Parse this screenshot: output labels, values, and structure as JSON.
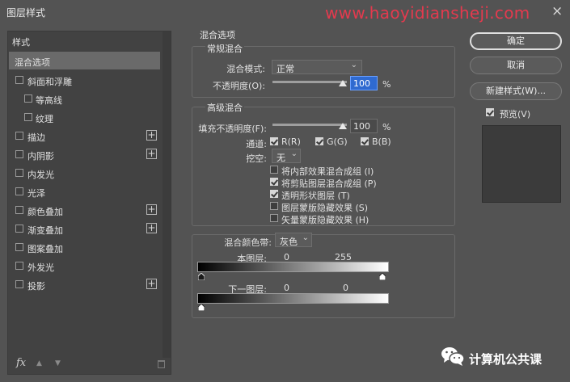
{
  "window": {
    "title": "图层样式",
    "watermark": "www.haoyidiansheji.com",
    "close_icon": "×"
  },
  "sidebar": {
    "header": "样式",
    "items": [
      {
        "label": "混合选项",
        "checkbox": false,
        "plus": false,
        "selected": true
      },
      {
        "label": "斜面和浮雕",
        "checkbox": true,
        "checked": false,
        "plus": false
      },
      {
        "label": "等高线",
        "checkbox": true,
        "checked": false,
        "plus": false,
        "indent": true
      },
      {
        "label": "纹理",
        "checkbox": true,
        "checked": false,
        "plus": false,
        "indent": true
      },
      {
        "label": "描边",
        "checkbox": true,
        "checked": false,
        "plus": true
      },
      {
        "label": "内阴影",
        "checkbox": true,
        "checked": false,
        "plus": true
      },
      {
        "label": "内发光",
        "checkbox": true,
        "checked": false,
        "plus": false
      },
      {
        "label": "光泽",
        "checkbox": true,
        "checked": false,
        "plus": false
      },
      {
        "label": "颜色叠加",
        "checkbox": true,
        "checked": false,
        "plus": true
      },
      {
        "label": "渐变叠加",
        "checkbox": true,
        "checked": false,
        "plus": true
      },
      {
        "label": "图案叠加",
        "checkbox": true,
        "checked": false,
        "plus": false
      },
      {
        "label": "外发光",
        "checkbox": true,
        "checked": false,
        "plus": false
      },
      {
        "label": "投影",
        "checkbox": true,
        "checked": false,
        "plus": true
      }
    ],
    "footer": {
      "fx_label": "fx",
      "up_arrow": "▲",
      "down_arrow": "▼"
    }
  },
  "blend_options": {
    "section_title": "混合选项",
    "general": {
      "title": "常规混合",
      "mode_label": "混合模式:",
      "mode_value": "正常",
      "opacity_label": "不透明度(O):",
      "opacity_value": "100",
      "opacity_unit": "%"
    },
    "advanced": {
      "title": "高级混合",
      "fill_label": "填充不透明度(F):",
      "fill_value": "100",
      "fill_unit": "%",
      "channels_label": "通道:",
      "channels": [
        {
          "label": "R(R)",
          "checked": true
        },
        {
          "label": "G(G)",
          "checked": true
        },
        {
          "label": "B(B)",
          "checked": true
        }
      ],
      "knockout_label": "挖空:",
      "knockout_value": "无",
      "options": [
        {
          "label": "将内部效果混合成组 (I)",
          "checked": false
        },
        {
          "label": "将剪贴图层混合成组 (P)",
          "checked": true
        },
        {
          "label": "透明形状图层 (T)",
          "checked": true
        },
        {
          "label": "图层蒙版隐藏效果 (S)",
          "checked": false
        },
        {
          "label": "矢量蒙版隐藏效果 (H)",
          "checked": false
        }
      ]
    },
    "blend_if": {
      "label": "混合颜色带:",
      "value": "灰色",
      "this_layer_label": "本图层:",
      "this_layer_low": "0",
      "this_layer_high": "255",
      "underlying_label": "下一图层:",
      "underlying_low": "0",
      "underlying_high": "0"
    }
  },
  "buttons": {
    "ok": "确定",
    "cancel": "取消",
    "new_style": "新建样式(W)...",
    "preview_label": "预览(V)",
    "preview_checked": true
  },
  "badge": {
    "text": "计算机公共课"
  },
  "colors": {
    "accent_active": "#2f6ad0",
    "watermark": "#e33a4e",
    "panel": "#424242",
    "background": "#535353"
  }
}
